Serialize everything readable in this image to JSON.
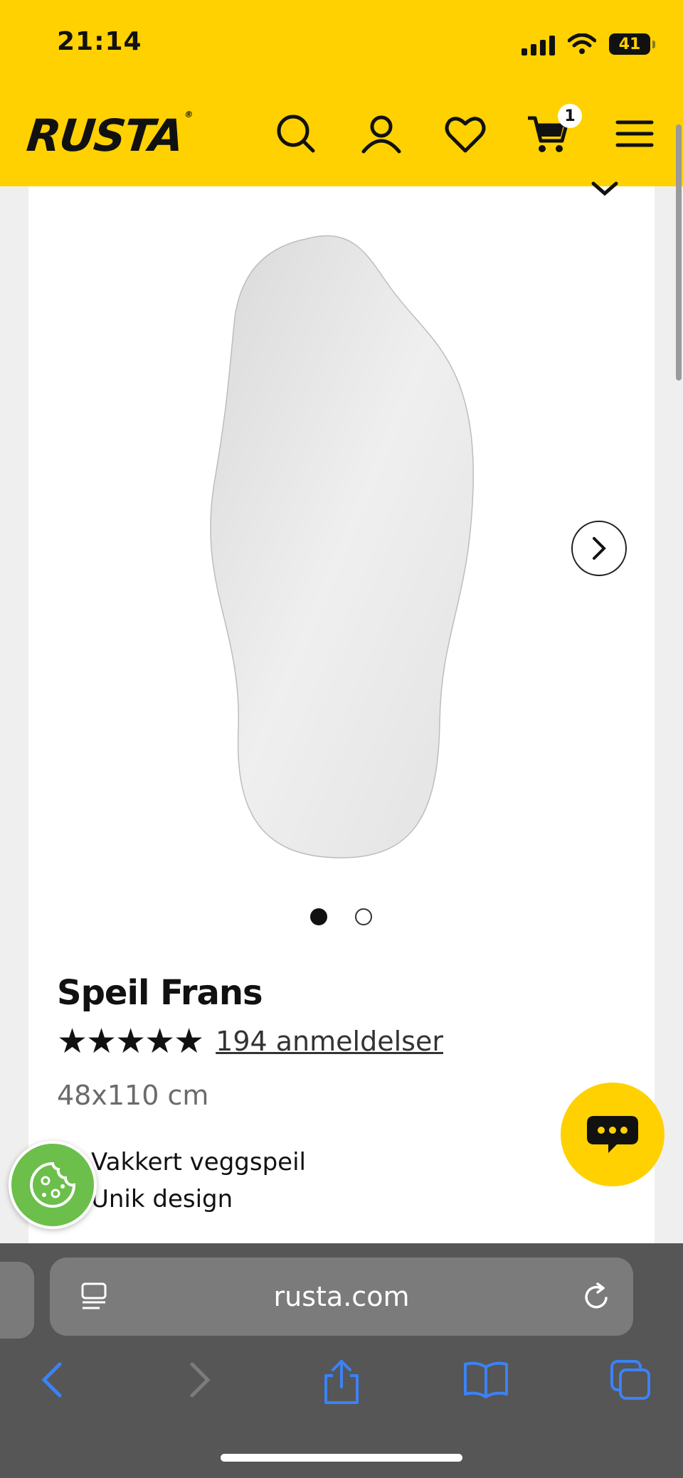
{
  "status": {
    "time": "21:14",
    "battery": "41"
  },
  "header": {
    "logo": "RUSTA",
    "cart_count": "1"
  },
  "product": {
    "title": "Speil Frans",
    "stars": "★★★★★",
    "reviews": "194 anmeldelser",
    "dimensions": "48x110 cm",
    "bullets": [
      "Vakkert veggspeil",
      "Unik design"
    ]
  },
  "browser": {
    "url": "rusta.com"
  },
  "colors": {
    "brand": "#ffd100",
    "cookie": "#6bbf4a",
    "link": "#3b82f6"
  }
}
